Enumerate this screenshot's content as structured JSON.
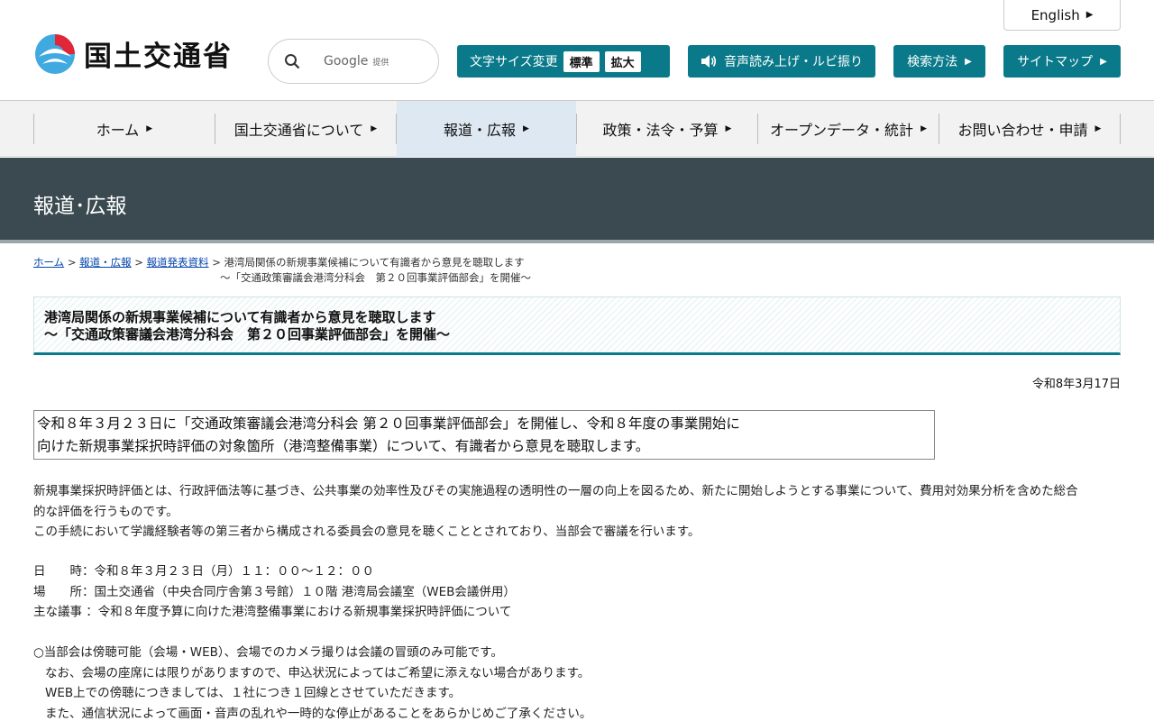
{
  "header": {
    "logo_text": "国土交通省",
    "english_label": "English",
    "search": {
      "placeholder_brand": "Google",
      "placeholder_note": "提供"
    },
    "font_size": {
      "label": "文字サイズ変更",
      "standard": "標準",
      "large": "拡大"
    },
    "voice_label": "音声読み上げ・ルビ振り",
    "howto_label": "検索方法",
    "sitemap_label": "サイトマップ"
  },
  "gnav": [
    {
      "label": "ホーム"
    },
    {
      "label": "国土交通省について"
    },
    {
      "label": "報道・広報"
    },
    {
      "label": "政策・法令・予算"
    },
    {
      "label": "オープンデータ・統計"
    },
    {
      "label": "お問い合わせ・申請"
    }
  ],
  "section_title": "報道･広報",
  "breadcrumb": {
    "items": [
      "ホーム",
      "報道・広報",
      "報道発表資料"
    ],
    "current_line1": "港湾局関係の新規事業候補について有識者から意見を聴取します",
    "current_line2": "～「交通政策審議会港湾分科会　第２０回事業評価部会」を開催～"
  },
  "article": {
    "title_line1": "港湾局関係の新規事業候補について有識者から意見を聴取します",
    "title_line2": "～「交通政策審議会港湾分科会　第２０回事業評価部会」を開催～",
    "date": "令和8年3月17日",
    "lead_line1": "令和８年３月２３日に「交通政策審議会港湾分科会 第２０回事業評価部会」を開催し、令和８年度の事業開始に",
    "lead_line2": "向けた新規事業採択時評価の対象箇所（港湾整備事業）について、有識者から意見を聴取します。",
    "para1_line1": "新規事業採択時評価とは、行政評価法等に基づき、公共事業の効率性及びその実施過程の透明性の一層の向上を図るため、新たに開始しようとする事業について、費用対効果分析を含めた総合",
    "para1_line2": "的な評価を行うものです。",
    "para1_line3": "この手続において学識経験者等の第三者から構成される委員会の意見を聴くこととされており、当部会で審議を行います。",
    "datetime": "日　　時：令和８年３月２３日（月）１１：００～１２：００",
    "place": "場　　所：国土交通省（中央合同庁舎第３号館）１０階 港湾局会議室（WEB会議併用）",
    "agenda": "主な議事 ：令和８年度予算に向けた港湾整備事業における新規事業採択時評価について",
    "note1": "○当部会は傍聴可能（会場・WEB）、会場でのカメラ撮りは会議の冒頭のみ可能です。",
    "note2": "なお、会場の座席には限りがありますので、申込状況によってはご希望に添えない場合があります。",
    "note3": "WEB上での傍聴につきましては、１社につき１回線とさせていただきます。",
    "note4": "また、通信状況によって画面・音声の乱れや一時的な停止があることをあらかじめご了承ください。"
  }
}
